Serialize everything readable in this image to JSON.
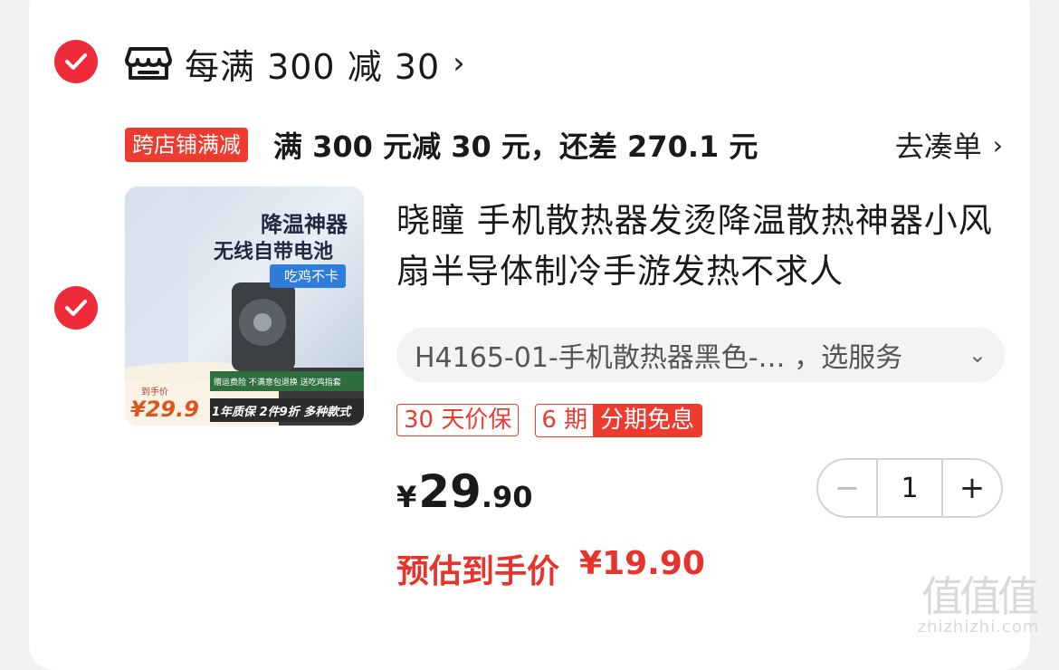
{
  "shop": {
    "title": "每满 300 减 30",
    "chevron": "›",
    "icon": "shop-icon"
  },
  "promo": {
    "tag": "跨店铺满减",
    "text": "满 300 元减 30 元，还差 270.1 元",
    "link": "去凑单",
    "link_chevron": "›"
  },
  "product": {
    "image_lines": [
      "降温神器",
      "无线自带电池"
    ],
    "image_tag": "吃鸡不卡",
    "image_price_label": "到手价",
    "image_price": "¥29.9",
    "image_banner_top": "赠运费险 不满意包退换 送吃鸡指套",
    "image_banner_bottom": "1年质保 2件9折 多种款式",
    "title": "晓瞳 手机散热器发烫降温散热神器小风扇半导体制冷手游发热不求人",
    "sku": "H4165-01-手机散热器黑色-… ，选服务",
    "sku_chevron": "⌄",
    "badge1": "30 天价保",
    "badge2_a": "6 期",
    "badge2_b": "分期免息",
    "price_currency": "¥",
    "price_int": "29",
    "price_dec": ".90",
    "quantity": "1",
    "minus": "−",
    "plus": "+",
    "est_label": "预估到手价",
    "est_value": "¥19.90"
  },
  "watermark": {
    "big": "值值值",
    "small": "zhizhizhi.com"
  },
  "colors": {
    "accent": "#ef2b3a",
    "promo_red": "#e8322b",
    "card": "#ffffff",
    "background": "#f2f2f2"
  }
}
